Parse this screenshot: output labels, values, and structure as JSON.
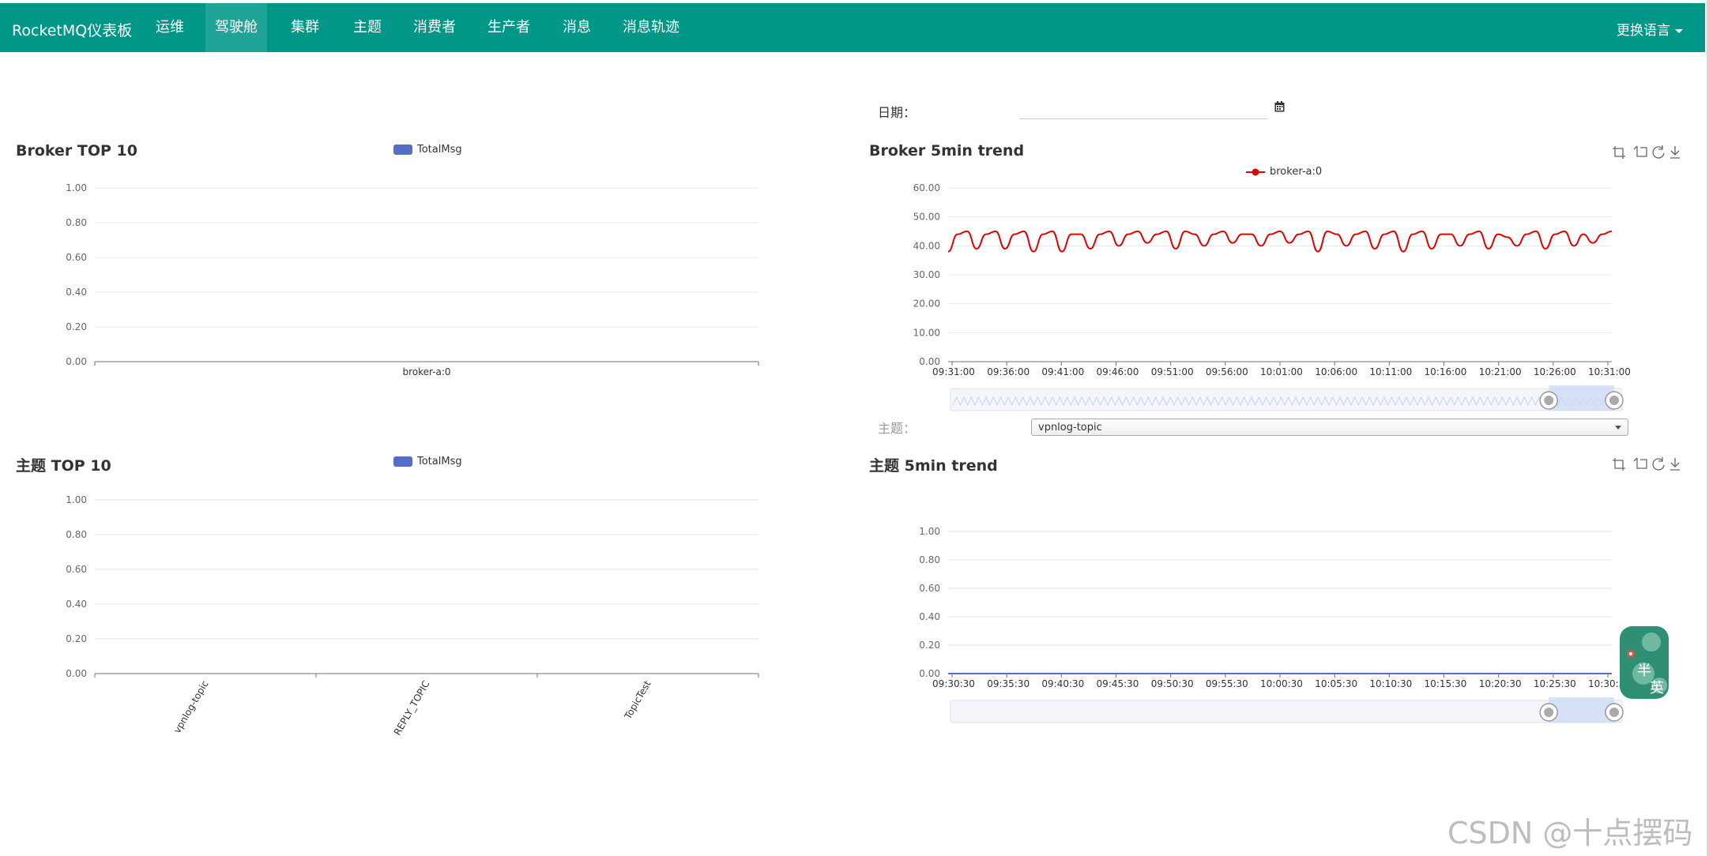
{
  "nav": {
    "brand": "RocketMQ仪表板",
    "items": [
      {
        "label": "运维"
      },
      {
        "label": "驾驶舱",
        "active": true
      },
      {
        "label": "集群"
      },
      {
        "label": "主题"
      },
      {
        "label": "消费者"
      },
      {
        "label": "生产者"
      },
      {
        "label": "消息"
      },
      {
        "label": "消息轨迹"
      }
    ],
    "language": "更换语言"
  },
  "filters": {
    "date_label": "日期：",
    "date_value": "",
    "topic_label": "主题：",
    "topic_value": "vpnlog-topic"
  },
  "panels": {
    "broker_top": {
      "title": "Broker TOP 10",
      "legend": "TotalMsg"
    },
    "broker_trend": {
      "title": "Broker 5min trend",
      "legend": "broker-a:0"
    },
    "topic_top": {
      "title": "主题 TOP 10",
      "legend": "TotalMsg"
    },
    "topic_trend": {
      "title": "主题 5min trend"
    }
  },
  "colors": {
    "nav": "#009688",
    "bar": "#5470c6",
    "trend_line": "#e00000",
    "topic_line": "#5470c6"
  },
  "icons": [
    "zoom-icon",
    "zoom-reset-icon",
    "restore-icon",
    "download-icon",
    "calendar-icon"
  ],
  "watermark": "CSDN @十点摆码",
  "widget": {
    "chars": [
      "半",
      "英"
    ]
  },
  "chart_data": [
    {
      "type": "bar",
      "title": "Broker TOP 10",
      "legend": [
        "TotalMsg"
      ],
      "categories": [
        "broker-a:0"
      ],
      "series": [
        {
          "name": "TotalMsg",
          "values": [
            0
          ]
        }
      ],
      "ylim": [
        0,
        1
      ],
      "yticks": [
        "0.00",
        "0.20",
        "0.40",
        "0.60",
        "0.80",
        "1.00"
      ],
      "grid": true,
      "legend_position": "top"
    },
    {
      "type": "line",
      "title": "Broker 5min trend",
      "legend": [
        "broker-a:0"
      ],
      "x": [
        "09:31:00",
        "09:36:00",
        "09:41:00",
        "09:46:00",
        "09:51:00",
        "09:56:00",
        "10:01:00",
        "10:06:00",
        "10:11:00",
        "10:16:00",
        "10:21:00",
        "10:26:00",
        "10:31:00"
      ],
      "series": [
        {
          "name": "broker-a:0",
          "values": [
            38,
            44,
            45,
            39,
            44,
            45,
            39,
            44,
            45,
            38,
            44,
            45,
            38,
            44,
            44,
            39,
            44,
            45,
            40,
            44,
            45,
            41,
            44,
            45,
            39,
            45,
            44,
            40,
            44,
            45,
            41,
            44,
            44,
            40,
            44,
            45,
            41,
            44,
            45,
            38,
            45,
            44,
            40,
            44,
            45,
            39,
            44,
            45,
            38,
            44,
            45,
            39,
            44,
            44,
            40,
            44,
            45,
            39,
            44,
            43,
            40,
            44,
            45,
            39,
            44,
            45,
            40,
            44,
            41,
            44,
            45
          ]
        }
      ],
      "ylim": [
        0,
        60
      ],
      "yticks": [
        "0.00",
        "10.00",
        "20.00",
        "30.00",
        "40.00",
        "50.00",
        "60.00"
      ],
      "grid": true,
      "legend_position": "top"
    },
    {
      "type": "bar",
      "title": "主题 TOP 10",
      "legend": [
        "TotalMsg"
      ],
      "categories": [
        "vpnlog-topic",
        "REPLY_TOPIC",
        "TopicTest"
      ],
      "series": [
        {
          "name": "TotalMsg",
          "values": [
            0,
            0,
            0
          ]
        }
      ],
      "ylim": [
        0,
        1
      ],
      "yticks": [
        "0.00",
        "0.20",
        "0.40",
        "0.60",
        "0.80",
        "1.00"
      ],
      "grid": true,
      "legend_position": "top"
    },
    {
      "type": "line",
      "title": "主题 5min trend",
      "x": [
        "09:30:30",
        "09:35:30",
        "09:40:30",
        "09:45:30",
        "09:50:30",
        "09:55:30",
        "10:00:30",
        "10:05:30",
        "10:10:30",
        "10:15:30",
        "10:20:30",
        "10:25:30",
        "10:30:30"
      ],
      "series": [
        {
          "values": [
            0,
            0,
            0,
            0,
            0,
            0,
            0,
            0,
            0,
            0,
            0,
            0,
            0
          ]
        }
      ],
      "ylim": [
        0,
        1
      ],
      "yticks": [
        "0.00",
        "0.20",
        "0.40",
        "0.60",
        "0.80",
        "1.00"
      ],
      "grid": true
    }
  ]
}
